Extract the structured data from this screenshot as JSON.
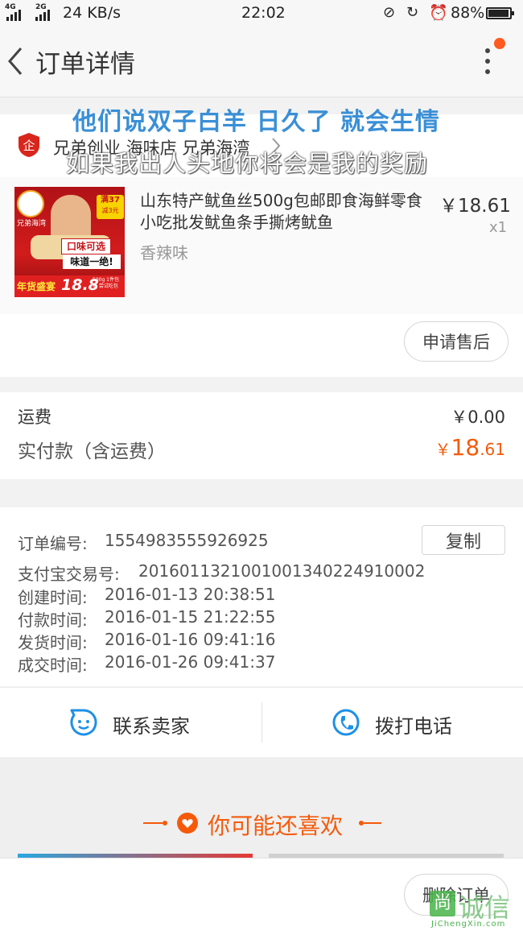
{
  "status_bar": {
    "network_1": "4G",
    "network_2": "2G",
    "speed": "24 KB/s",
    "time": "22:02",
    "battery": "88%"
  },
  "header": {
    "title": "订单详情"
  },
  "overlay_text": {
    "line1": "他们说双子白羊 日久了 就会生情",
    "line2": "如果我出人头地你将会是我的奖励"
  },
  "shop": {
    "name": "兄弟创业 海味店 兄弟海湾"
  },
  "product": {
    "title": "山东特产鱿鱼丝500g包邮即食海鲜零食小吃批发鱿鱼条手撕烤鱿鱼",
    "price": "￥18.61",
    "quantity": "x1",
    "sku": "香辣味",
    "thumb_brand": "兄弟海湾",
    "thumb_badge_top": "满37",
    "thumb_badge_bottom": "减3元",
    "thumb_slogan_1": "口味可选",
    "thumb_slogan_2": "味道一绝!",
    "thumb_banner": "年货盛宴",
    "thumb_price": "18.8",
    "thumb_note": "500g 1件包邮 尝试吃包"
  },
  "after_sales_button": "申请售后",
  "payment": {
    "shipping_label": "运费",
    "shipping_value": "￥0.00",
    "total_label": "实付款（含运费）",
    "total_currency": "￥",
    "total_int": "18",
    "total_dec": ".61"
  },
  "order_info": {
    "order_no_label": "订单编号:",
    "order_no": "1554983555926925",
    "copy_button": "复制",
    "alipay_label": "支付宝交易号:",
    "alipay_no": "2016011321001001340224910002",
    "created_label": "创建时间:",
    "created": "2016-01-13 20:38:51",
    "paid_label": "付款时间:",
    "paid": "2016-01-15 21:22:55",
    "shipped_label": "发货时间:",
    "shipped": "2016-01-16 09:41:16",
    "completed_label": "成交时间:",
    "completed": "2016-01-26 09:41:37"
  },
  "actions": {
    "contact_seller": "联系卖家",
    "call_phone": "拨打电话"
  },
  "recommend": {
    "title": "你可能还喜欢"
  },
  "bottom": {
    "delete_order": "删除订单"
  },
  "watermark": {
    "text": "诚信",
    "url": "JiChengXin.com"
  },
  "colors": {
    "accent": "#f55a0b",
    "icon_blue": "#1e90e6",
    "notif_dot": "#ff5a1f"
  }
}
